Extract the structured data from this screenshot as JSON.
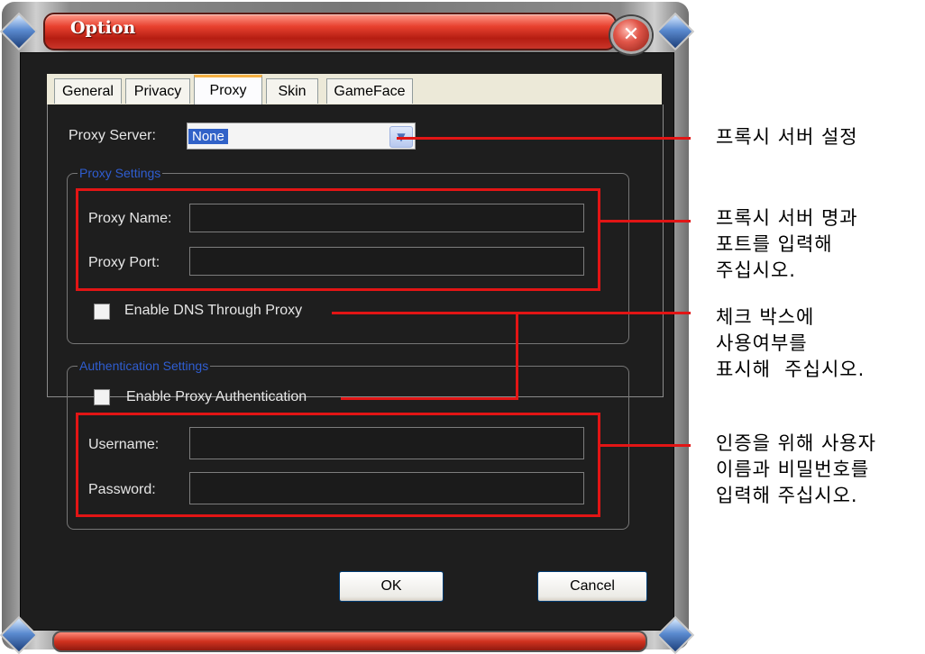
{
  "window": {
    "title": "Option",
    "close_icon": "close-icon"
  },
  "tabs": [
    "General",
    "Privacy",
    "Proxy",
    "Skin",
    "GameFace"
  ],
  "active_tab": "Proxy",
  "proxy_server": {
    "label": "Proxy Server:",
    "value": "None"
  },
  "proxy_settings": {
    "legend": "Proxy Settings",
    "name_label": "Proxy Name:",
    "name_value": "",
    "port_label": "Proxy Port:",
    "port_value": "",
    "dns_label": "Enable DNS Through Proxy"
  },
  "auth_settings": {
    "legend": "Authentication Settings",
    "enable_label": "Enable Proxy Authentication",
    "username_label": "Username:",
    "username_value": "",
    "password_label": "Password:",
    "password_value": ""
  },
  "buttons": {
    "ok": "OK",
    "cancel": "Cancel"
  },
  "annotations": {
    "proxy_server_note": "프록시 서버 설정",
    "proxy_settings_note": "프록시 서버 명과\n포트를 입력해\n주십시오.",
    "checkbox_note": "체크 박스에\n사용여부를\n표시해  주십시오.",
    "auth_note": "인증을 위해 사용자\n이름과 비밀번호를\n입력해 주십시오."
  },
  "colors": {
    "title_red": "#d0321f",
    "annotation_red": "#e21515",
    "legend_blue": "#2f5dd0",
    "tab_highlight": "#f5b042"
  }
}
